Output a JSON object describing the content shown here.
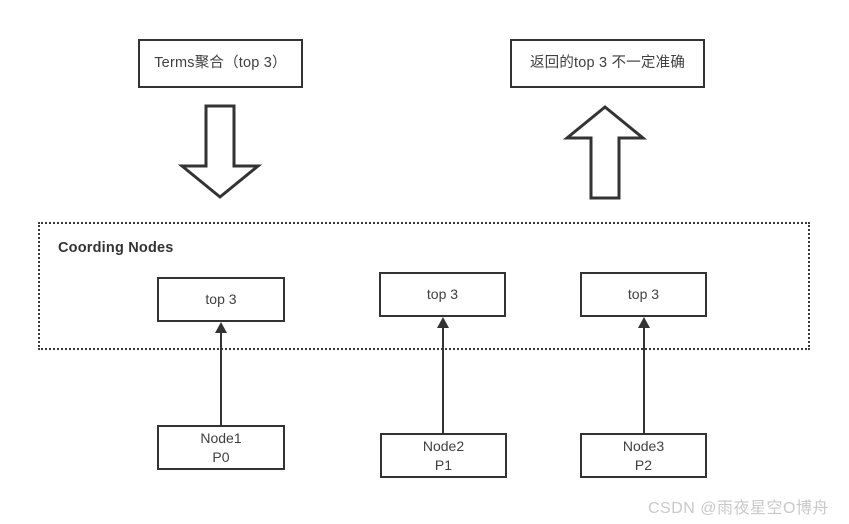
{
  "diagram": {
    "title": "Elasticsearch terms aggregation top-N accuracy diagram",
    "colors": {
      "stroke": "#333333",
      "text": "#404040",
      "dashed_border": "#3a3a3a",
      "background": "#ffffff",
      "watermark": "#c9c9c9"
    },
    "captions": [
      {
        "id": "caption-left",
        "text": "Terms聚合（top 3）"
      },
      {
        "id": "caption-right",
        "text": "返回的top 3 不一定准确"
      }
    ],
    "arrows": [
      {
        "id": "block-arrow-down",
        "direction": "down",
        "meaning": "request-flow-down"
      },
      {
        "id": "block-arrow-up",
        "direction": "up",
        "meaning": "response-flow-up"
      }
    ],
    "coording_group": {
      "label": "Coording Nodes",
      "border_style": "dotted",
      "results": [
        {
          "id": "top3-box-1",
          "text": "top 3"
        },
        {
          "id": "top3-box-2",
          "text": "top 3"
        },
        {
          "id": "top3-box-3",
          "text": "top 3"
        }
      ]
    },
    "nodes": [
      {
        "id": "node-box-1",
        "name": "Node1",
        "shard": "P0",
        "text": "Node1\nP0"
      },
      {
        "id": "node-box-2",
        "name": "Node2",
        "shard": "P1",
        "text": "Node2\nP1"
      },
      {
        "id": "node-box-3",
        "name": "Node3",
        "shard": "P2",
        "text": "Node3\nP2"
      }
    ],
    "connectors": [
      {
        "id": "connector-1",
        "from": "Node1",
        "to": "top3-box-1",
        "direction": "up"
      },
      {
        "id": "connector-2",
        "from": "Node2",
        "to": "top3-box-2",
        "direction": "up"
      },
      {
        "id": "connector-3",
        "from": "Node3",
        "to": "top3-box-3",
        "direction": "up"
      }
    ],
    "watermark": "CSDN @雨夜星空O博舟"
  }
}
